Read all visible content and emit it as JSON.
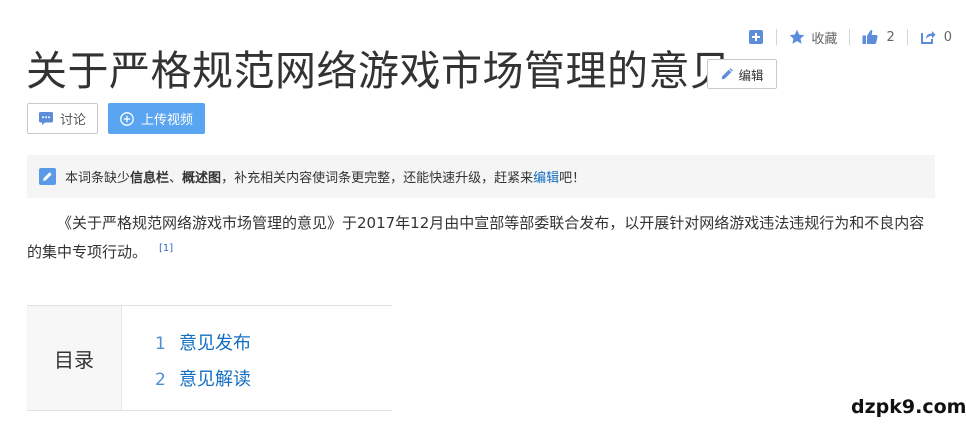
{
  "toolbar": {
    "add_icon": "plus-square-icon",
    "favorite_label": "收藏",
    "like_count": "2",
    "share_count": "0",
    "accent_color": "#5b8ddb"
  },
  "title": "关于严格规范网络游戏市场管理的意见",
  "edit_label": "编辑",
  "actions": {
    "discuss_label": "讨论",
    "upload_video_label": "上传视频"
  },
  "notice": {
    "prefix": "本词条缺少",
    "bold1": "信息栏",
    "sep": "、",
    "bold2": "概述图",
    "middle": "，补充相关内容使词条更完整，还能快速升级，赶紧来",
    "link": "编辑",
    "suffix": "吧！"
  },
  "summary": {
    "text": "《关于严格规范网络游戏市场管理的意见》于2017年12月由中宣部等部委联合发布，以开展针对网络游戏违法违规行为和不良内容的集中专项行动。",
    "ref": "[1]"
  },
  "catalog": {
    "label": "目录",
    "items": [
      {
        "num": "1",
        "label": "意见发布"
      },
      {
        "num": "2",
        "label": "意见解读"
      }
    ]
  },
  "watermark": "dzpk9.com",
  "colors": {
    "link": "#136ec2",
    "upload_button": "#5aa5f2",
    "notice_bg": "#f5f5f5"
  }
}
